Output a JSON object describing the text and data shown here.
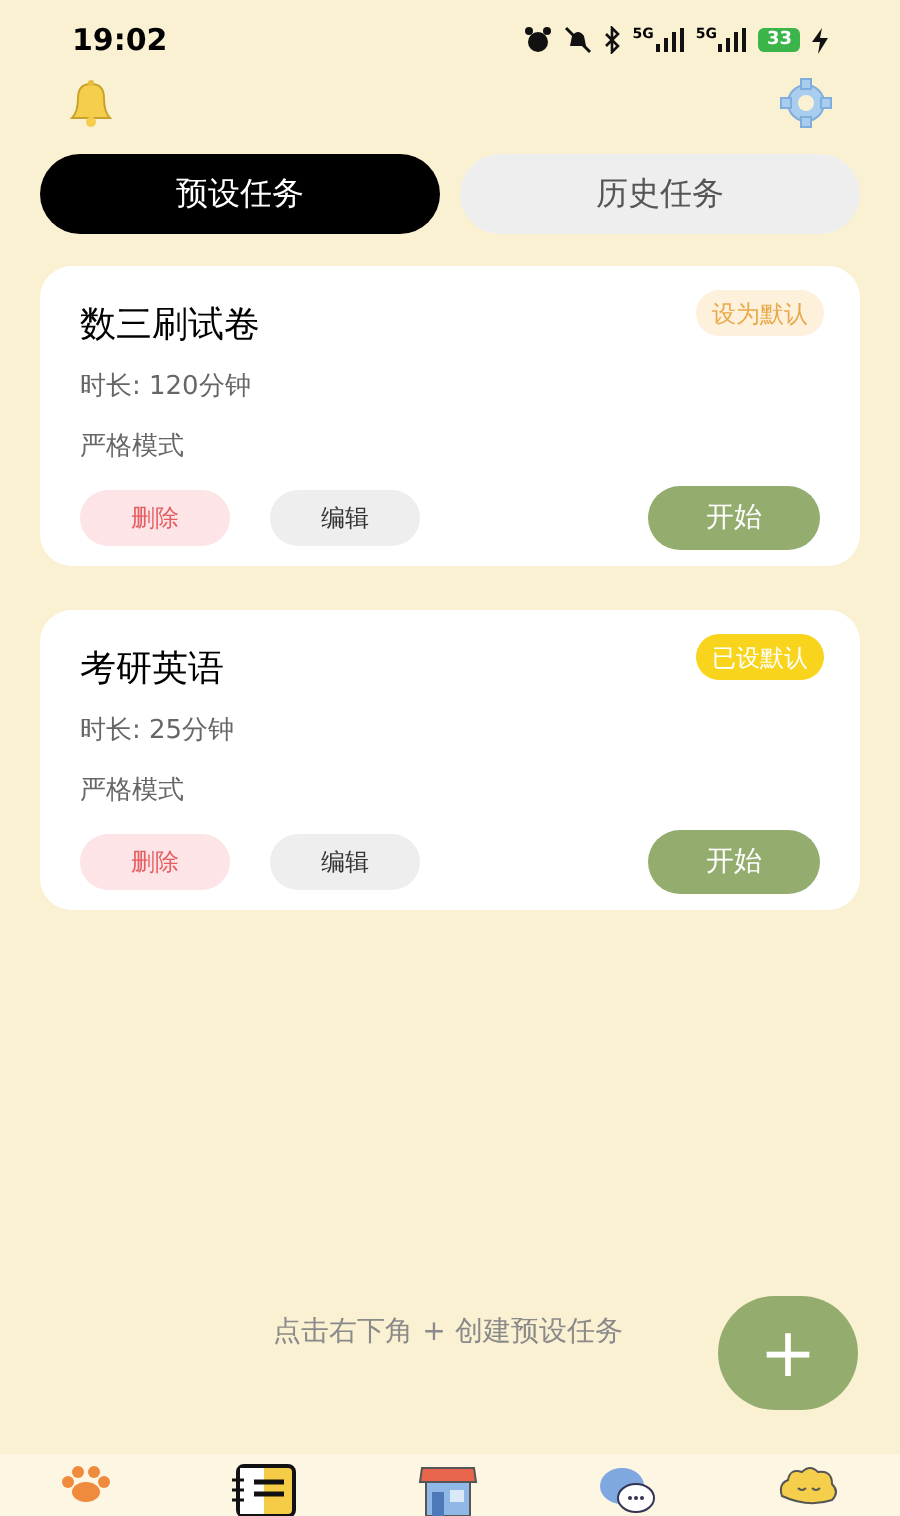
{
  "status_bar": {
    "time": "19:02",
    "signal_labels": [
      "5G",
      "5G"
    ],
    "battery": "33"
  },
  "tabs": [
    {
      "label": "预设任务",
      "selected": true
    },
    {
      "label": "历史任务",
      "selected": false
    }
  ],
  "tasks": [
    {
      "title": "数三刷试卷",
      "duration": "时长: 120分钟",
      "mode": "严格模式",
      "default_label": "设为默认",
      "is_default": false,
      "delete": "删除",
      "edit": "编辑",
      "start": "开始"
    },
    {
      "title": "考研英语",
      "duration": "时长: 25分钟",
      "mode": "严格模式",
      "default_label": "已设默认",
      "is_default": true,
      "delete": "删除",
      "edit": "编辑",
      "start": "开始"
    }
  ],
  "hint": "点击右下角 + 创建预设任务",
  "fab": "+"
}
